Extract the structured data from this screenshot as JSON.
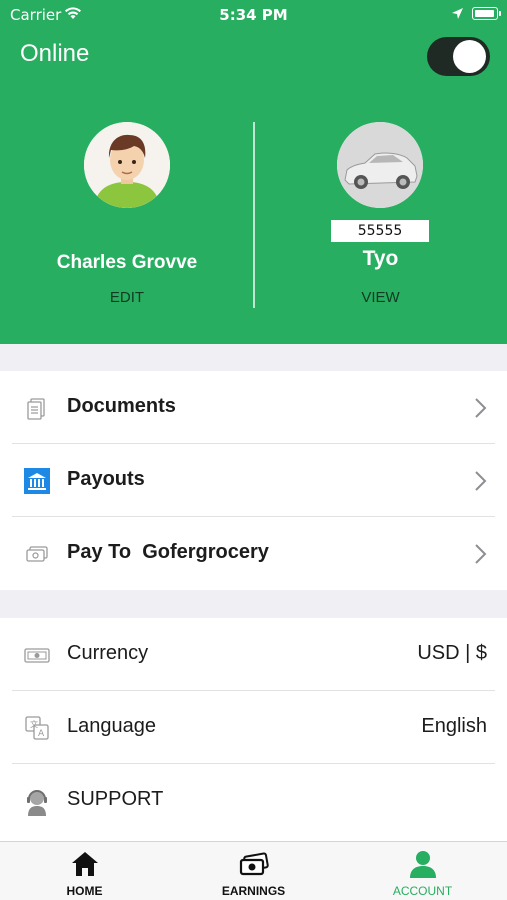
{
  "status_bar": {
    "carrier": "Carrier",
    "time": "5:34 PM"
  },
  "header": {
    "title": "Online",
    "online_toggle": true,
    "driver": {
      "name": "Charles Grovve",
      "action": "EDIT"
    },
    "vehicle": {
      "plate": "55555",
      "name": "Tyo",
      "action": "VIEW"
    }
  },
  "account_menu": [
    {
      "label": "Documents",
      "icon": "documents-icon"
    },
    {
      "label": "Payouts",
      "icon": "bank-icon"
    },
    {
      "label": "Pay To  Gofergrocery",
      "icon": "cash-icon"
    }
  ],
  "settings": [
    {
      "label": "Currency",
      "value": "USD | $",
      "icon": "currency-icon"
    },
    {
      "label": "Language",
      "value": "English",
      "icon": "language-icon"
    },
    {
      "label": "SUPPORT",
      "icon": "support-icon"
    }
  ],
  "tabs": [
    {
      "label": "HOME",
      "icon": "home-icon"
    },
    {
      "label": "EARNINGS",
      "icon": "earnings-icon"
    },
    {
      "label": "ACCOUNT",
      "icon": "account-icon",
      "active": true
    }
  ],
  "colors": {
    "primary_green": "#27ae60",
    "toggle_dark": "#1f2a24",
    "background": "#efeff4"
  }
}
